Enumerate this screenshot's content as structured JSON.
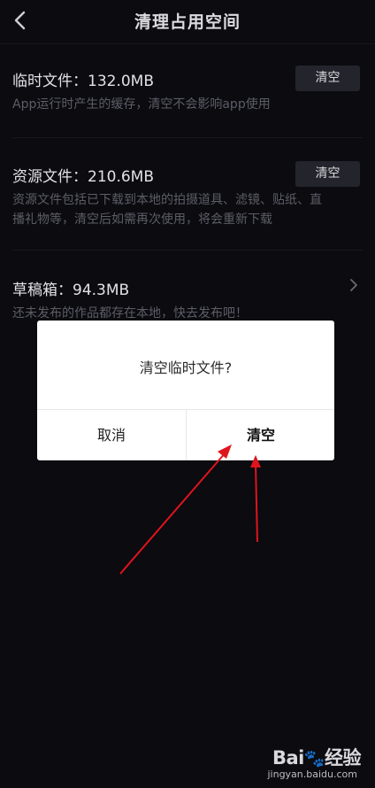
{
  "header": {
    "title": "清理占用空间"
  },
  "sections": [
    {
      "title": "临时文件：132.0MB",
      "desc": "App运行时产生的缓存，清空不会影响app使用",
      "button": "清空"
    },
    {
      "title": "资源文件：210.6MB",
      "desc_line1": "资源文件包括已下载到本地的拍摄道具、滤镜、贴纸、直",
      "desc_line2": "播礼物等，清空后如需再次使用，将会重新下载",
      "button": "清空"
    },
    {
      "title": "草稿箱：94.3MB",
      "desc": "还未发布的作品都存在本地，快去发布吧！"
    }
  ],
  "dialog": {
    "message": "清空临时文件?",
    "cancel": "取消",
    "confirm": "清空"
  },
  "watermark": {
    "logo": "Bai百经验",
    "url": "jingyan.baidu.com"
  },
  "colors": {
    "background": "#0b0b10",
    "button_bg": "#24252c",
    "arrow": "#e0141c"
  }
}
